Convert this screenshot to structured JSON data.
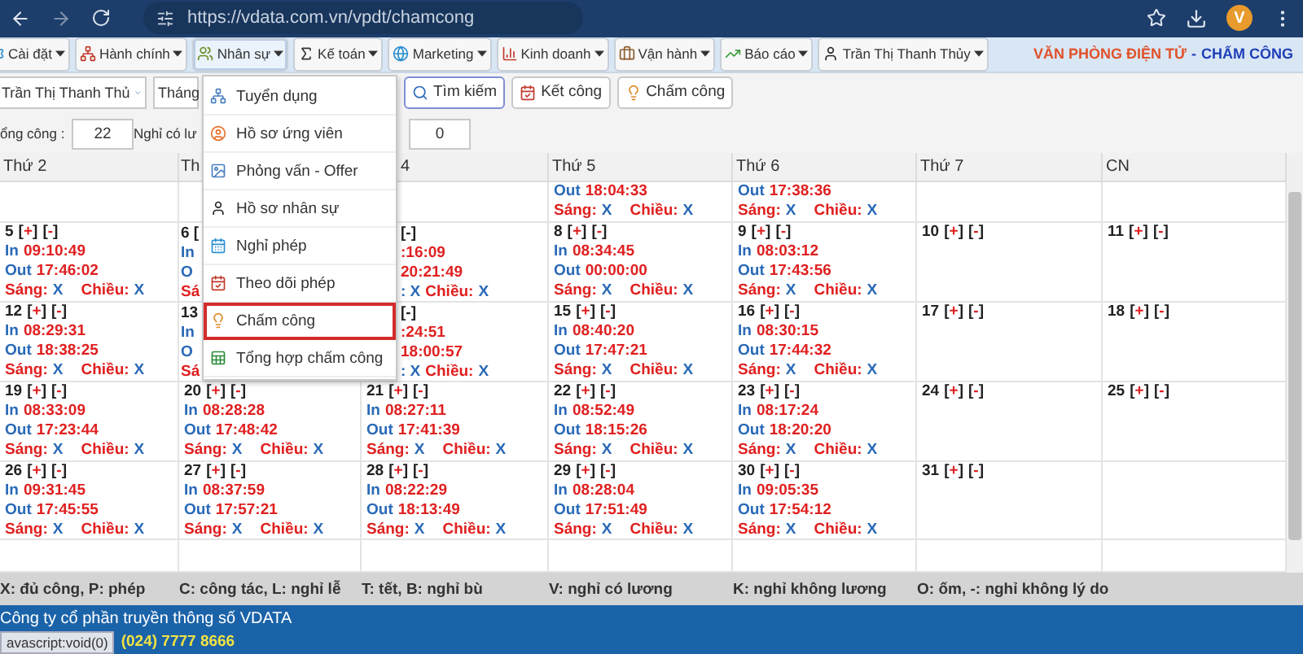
{
  "browser": {
    "url": "https://vdata.com.vn/vpdt/chamcong",
    "avatar": "V"
  },
  "menubar": {
    "items": [
      {
        "label": "Cài đặt",
        "selected": false
      },
      {
        "label": "Hành chính",
        "selected": false
      },
      {
        "label": "Nhân sự",
        "selected": true
      },
      {
        "label": "Kế toán",
        "selected": false
      },
      {
        "label": "Marketing",
        "selected": false
      },
      {
        "label": "Kinh doanh",
        "selected": false
      },
      {
        "label": "Vận hành",
        "selected": false
      },
      {
        "label": "Báo cáo",
        "selected": false
      },
      {
        "label": "Trần Thị Thanh Thủy",
        "selected": false
      }
    ],
    "title": {
      "left": "VĂN PHÒNG ĐIỆN TỬ",
      "separator": "-",
      "right": "CHẤM CÔNG"
    }
  },
  "filters": {
    "employee": "Trần Thị Thanh Thủ",
    "month": "Tháng",
    "buttons": [
      "Tìm kiếm",
      "Kết công",
      "Chấm công"
    ]
  },
  "totals": [
    {
      "label": "ổng công :",
      "value": "22"
    },
    {
      "label": "Nghỉ có lư"
    },
    {
      "value": "0"
    }
  ],
  "dropdown": {
    "items": [
      {
        "label": "Tuyển dụng",
        "selected": false
      },
      {
        "label": "Hồ sơ ứng viên",
        "selected": false
      },
      {
        "label": "Phỏng vấn - Offer",
        "selected": false
      },
      {
        "label": "Hồ sơ nhân sự",
        "selected": false
      },
      {
        "label": "Nghỉ phép",
        "selected": false
      },
      {
        "label": "Theo dõi phép",
        "selected": false
      },
      {
        "label": "Chấm công",
        "selected": true
      },
      {
        "label": "Tổng hợp chấm công",
        "selected": false
      }
    ]
  },
  "calendar": {
    "columns": [
      "Thứ 2",
      "Th",
      "4",
      "Thứ 5",
      "Thứ 6",
      "Thứ 7",
      "CN"
    ],
    "rows": [
      [
        {
          "kind": "blank"
        },
        {
          "kind": "blank"
        },
        {
          "kind": "blank"
        },
        {
          "kind": "tail",
          "out": [
            "Out",
            "18:04:33"
          ],
          "shift": [
            "Sáng:",
            "X",
            "Chiều:",
            "X"
          ]
        },
        {
          "kind": "tail",
          "out": [
            "Out",
            "17:38:36"
          ],
          "shift": [
            "Sáng:",
            "X",
            "Chiều:",
            "X"
          ]
        },
        {
          "kind": "blank"
        },
        {
          "kind": "blank"
        }
      ],
      [
        {
          "kind": "full",
          "day": "5",
          "add": "[+]",
          "remove": "[-]",
          "in": [
            "In",
            "09:10:49"
          ],
          "out": [
            "Out",
            "17:46:02"
          ],
          "shift": [
            "Sáng:",
            "X",
            "Chiều:",
            "X"
          ]
        },
        {
          "kind": "fragment",
          "lines": [
            [
              "6 ["
            ],
            [
              "In"
            ],
            [
              "O"
            ],
            [
              "Sá"
            ]
          ]
        },
        {
          "kind": "remnant",
          "lines": [
            [
              "[-]"
            ],
            [
              ":16:09"
            ],
            [
              "20:21:49"
            ],
            [
              ": X",
              "Chiều:",
              "X"
            ]
          ]
        },
        {
          "kind": "full",
          "day": "8",
          "add": "[+]",
          "remove": "[-]",
          "in": [
            "In",
            "08:34:45"
          ],
          "out": [
            "Out",
            "00:00:00"
          ],
          "shift": [
            "Sáng:",
            "X",
            "Chiều:",
            "X"
          ]
        },
        {
          "kind": "full",
          "day": "9",
          "add": "[+]",
          "remove": "[-]",
          "in": [
            "In",
            "08:03:12"
          ],
          "out": [
            "Out",
            "17:43:56"
          ],
          "shift": [
            "Sáng:",
            "X",
            "Chiều:",
            "X"
          ]
        },
        {
          "kind": "day",
          "day": "10",
          "add": "[+]",
          "remove": "[-]"
        },
        {
          "kind": "day",
          "day": "11",
          "add": "[+]",
          "remove": "[-]"
        }
      ],
      [
        {
          "kind": "full",
          "day": "12",
          "add": "[+]",
          "remove": "[-]",
          "in": [
            "In",
            "08:29:31"
          ],
          "out": [
            "Out",
            "18:38:25"
          ],
          "shift": [
            "Sáng:",
            "X",
            "Chiều:",
            "X"
          ]
        },
        {
          "kind": "fragment",
          "lines": [
            [
              "13"
            ],
            [
              "In"
            ],
            [
              "O"
            ],
            [
              "Sá"
            ]
          ]
        },
        {
          "kind": "remnant",
          "lines": [
            [
              "[-]"
            ],
            [
              ":24:51"
            ],
            [
              "18:00:57"
            ],
            [
              ": X",
              "Chiều:",
              "X"
            ]
          ]
        },
        {
          "kind": "full",
          "day": "15",
          "add": "[+]",
          "remove": "[-]",
          "in": [
            "In",
            "08:40:20"
          ],
          "out": [
            "Out",
            "17:47:21"
          ],
          "shift": [
            "Sáng:",
            "X",
            "Chiều:",
            "X"
          ]
        },
        {
          "kind": "full",
          "day": "16",
          "add": "[+]",
          "remove": "[-]",
          "in": [
            "In",
            "08:30:15"
          ],
          "out": [
            "Out",
            "17:44:32"
          ],
          "shift": [
            "Sáng:",
            "X",
            "Chiều:",
            "X"
          ]
        },
        {
          "kind": "day",
          "day": "17",
          "add": "[+]",
          "remove": "[-]"
        },
        {
          "kind": "day",
          "day": "18",
          "add": "[+]",
          "remove": "[-]"
        }
      ],
      [
        {
          "kind": "full",
          "day": "19",
          "add": "[+]",
          "remove": "[-]",
          "in": [
            "In",
            "08:33:09"
          ],
          "out": [
            "Out",
            "17:23:44"
          ],
          "shift": [
            "Sáng:",
            "X",
            "Chiều:",
            "X"
          ]
        },
        {
          "kind": "full",
          "day": "20",
          "add": "[+]",
          "remove": "[-]",
          "in": [
            "In",
            "08:28:28"
          ],
          "out": [
            "Out",
            "17:48:42"
          ],
          "shift": [
            "Sáng:",
            "X",
            "Chiều:",
            "X"
          ]
        },
        {
          "kind": "full",
          "day": "21",
          "add": "[+]",
          "remove": "[-]",
          "in": [
            "In",
            "08:27:11"
          ],
          "out": [
            "Out",
            "17:41:39"
          ],
          "shift": [
            "Sáng:",
            "X",
            "Chiều:",
            "X"
          ]
        },
        {
          "kind": "full",
          "day": "22",
          "add": "[+]",
          "remove": "[-]",
          "in": [
            "In",
            "08:52:49"
          ],
          "out": [
            "Out",
            "18:15:26"
          ],
          "shift": [
            "Sáng:",
            "X",
            "Chiều:",
            "X"
          ]
        },
        {
          "kind": "full",
          "day": "23",
          "add": "[+]",
          "remove": "[-]",
          "in": [
            "In",
            "08:17:24"
          ],
          "out": [
            "Out",
            "18:20:20"
          ],
          "shift": [
            "Sáng:",
            "X",
            "Chiều:",
            "X"
          ]
        },
        {
          "kind": "day",
          "day": "24",
          "add": "[+]",
          "remove": "[-]"
        },
        {
          "kind": "day",
          "day": "25",
          "add": "[+]",
          "remove": "[-]"
        }
      ],
      [
        {
          "kind": "full",
          "day": "26",
          "add": "[+]",
          "remove": "[-]",
          "in": [
            "In",
            "09:31:45"
          ],
          "out": [
            "Out",
            "17:45:55"
          ],
          "shift": [
            "Sáng:",
            "X",
            "Chiều:",
            "X"
          ]
        },
        {
          "kind": "full",
          "day": "27",
          "add": "[+]",
          "remove": "[-]",
          "in": [
            "In",
            "08:37:59"
          ],
          "out": [
            "Out",
            "17:57:21"
          ],
          "shift": [
            "Sáng:",
            "X",
            "Chiều:",
            "X"
          ]
        },
        {
          "kind": "full",
          "day": "28",
          "add": "[+]",
          "remove": "[-]",
          "in": [
            "In",
            "08:22:29"
          ],
          "out": [
            "Out",
            "18:13:49"
          ],
          "shift": [
            "Sáng:",
            "X",
            "Chiều:",
            "X"
          ]
        },
        {
          "kind": "full",
          "day": "29",
          "add": "[+]",
          "remove": "[-]",
          "in": [
            "In",
            "08:28:04"
          ],
          "out": [
            "Out",
            "17:51:49"
          ],
          "shift": [
            "Sáng:",
            "X",
            "Chiều:",
            "X"
          ]
        },
        {
          "kind": "full",
          "day": "30",
          "add": "[+]",
          "remove": "[-]",
          "in": [
            "In",
            "09:05:35"
          ],
          "out": [
            "Out",
            "17:54:12"
          ],
          "shift": [
            "Sáng:",
            "X",
            "Chiều:",
            "X"
          ]
        },
        {
          "kind": "day",
          "day": "31",
          "add": "[+]",
          "remove": "[-]"
        },
        {
          "kind": "blank"
        }
      ],
      [
        {
          "kind": "blank"
        },
        {
          "kind": "blank"
        },
        {
          "kind": "blank"
        },
        {
          "kind": "blank"
        },
        {
          "kind": "blank"
        },
        {
          "kind": "blank"
        },
        {
          "kind": "blank"
        }
      ]
    ]
  },
  "legend": [
    "X: đủ công, P: phép",
    "C: công tác, L: nghỉ lễ",
    "T: tết, B: nghỉ bù",
    "V: nghỉ có lương",
    "K: nghỉ không lương",
    "O: ốm, -: nghỉ không lý do"
  ],
  "footer": {
    "company": "Công ty cổ phần truyền thông số VDATA",
    "status_link": "avascript:void(0)",
    "phone": "(024) 7777 8666"
  }
}
